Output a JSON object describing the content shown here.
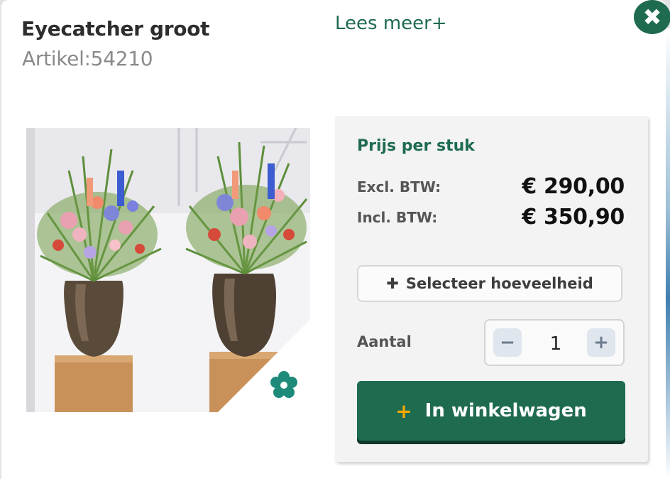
{
  "product": {
    "title": "Eyecatcher groot",
    "article": "Artikel:54210",
    "read_more": "Lees meer+",
    "image_alt": "Twee bronzen vazen met bloemstukken op houten zuilen"
  },
  "close": {
    "icon": "close-icon",
    "glyph": "✖"
  },
  "pricing": {
    "heading": "Prijs per stuk",
    "excl_label": "Excl. BTW:",
    "excl_value": "€ 290,00",
    "incl_label": "Incl. BTW:",
    "incl_value": "€ 350,90"
  },
  "quantity": {
    "select_label": "Selecteer hoeveelheid",
    "label": "Aantal",
    "value": "1",
    "minus": "−",
    "plus": "+"
  },
  "cart": {
    "label": "In winkelwagen",
    "plus": "+"
  },
  "colors": {
    "brand_green": "#1f6b4f",
    "accent_yellow": "#f2a900"
  }
}
